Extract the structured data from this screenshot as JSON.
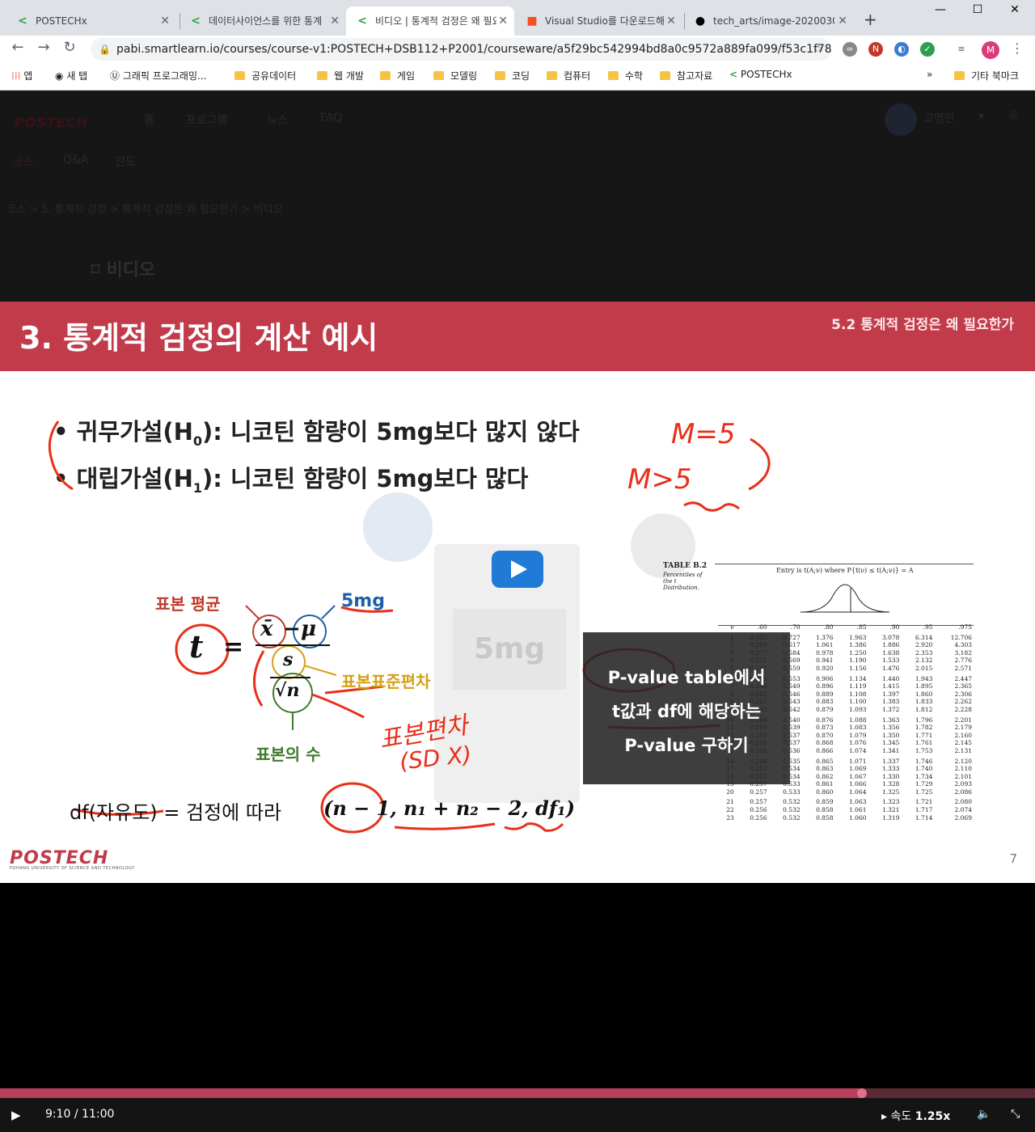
{
  "browser": {
    "tabs": [
      {
        "title": "POSTECHx"
      },
      {
        "title": "데이터사이언스를 위한 통계"
      },
      {
        "title": "비디오 | 통계적 검정은 왜 필요한가"
      },
      {
        "title": "Visual Studio를 다운로드해"
      },
      {
        "title": "tech_arts/image-2020030"
      }
    ],
    "url": "pabi.smartlearn.io/courses/course-v1:POSTECH+DSB112+P2001/courseware/a5f29bc542994bd8a0c9572a889fa099/f53c1f78ceb24055a...",
    "profile_initial": "M",
    "bookmarks": [
      "앱",
      "새 탭",
      "그래픽 프로그래밍...",
      "공유데이터",
      "웹 개발",
      "게임",
      "모델링",
      "코딩",
      "컴퓨터",
      "수학",
      "참고자료",
      "POSTECHx"
    ],
    "bookmarks_more": "»",
    "other_bookmarks": "기타 북마크"
  },
  "site": {
    "logo": "POSTECH",
    "nav": [
      "홈",
      "프로그램",
      "뉴스",
      "FAQ"
    ],
    "user": "고영인",
    "subnav": [
      "코스",
      "Q&A",
      "진도"
    ],
    "breadcrumb": "코스 > 5. 통계적 검정 > 통계적 검정은 왜 필요한가 > 비디오",
    "video_title": "비디오"
  },
  "slide": {
    "title": "3. 통계적 검정의 계산 예시",
    "section": "5.2 통계적 검정은 왜 필요한가",
    "h0_prefix": "귀무가설(H",
    "h0_sub": "0",
    "h0_rest": "): 니코틴 함량이 5mg보다 많지 않다",
    "h1_prefix": "대립가설(H",
    "h1_sub": "1",
    "h1_rest": "): 니코틴 함량이 5mg보다 많다",
    "hand_h0": "M=5",
    "hand_h1": "M>5",
    "label_mean": "표본 평균",
    "label_5mg": "5mg",
    "label_sd": "표본표준편차",
    "label_n": "표본의 수",
    "hand_sd": "표본편차",
    "hand_sd2": "(SD X)",
    "formula_t": "t",
    "formula_eq": "=",
    "formula_xbar": "x̄",
    "formula_minus": "−",
    "formula_mu": "μ",
    "formula_s": "s",
    "formula_sqrtn": "√n",
    "df_text": "df(자유도) = 검정에 따라",
    "df_values": "(n − 1, n₁ + n₂ − 2, df₁)",
    "cigarette_text": "5mg",
    "overlay_lines": [
      "P-value table에서",
      "t값과 df에 해당하는",
      "P-value 구하기"
    ],
    "table_title": "TABLE B.2",
    "table_subtitle": "Percentiles of the t Distribution.",
    "table_entry": "Entry is t(A;ν) where P{t(ν) ≤ t(A;ν)} = A",
    "table_header": [
      "ν",
      ".60",
      ".70",
      ".80",
      ".85",
      ".90",
      ".95",
      ".975"
    ],
    "table_rows": [
      [
        "1",
        "0.325",
        "0.727",
        "1.376",
        "1.963",
        "3.078",
        "6.314",
        "12.706"
      ],
      [
        "2",
        "0.289",
        "0.617",
        "1.061",
        "1.386",
        "1.886",
        "2.920",
        "4.303"
      ],
      [
        "3",
        "0.277",
        "0.584",
        "0.978",
        "1.250",
        "1.638",
        "2.353",
        "3.182"
      ],
      [
        "4",
        "0.271",
        "0.569",
        "0.941",
        "1.190",
        "1.533",
        "2.132",
        "2.776"
      ],
      [
        "5",
        "0.267",
        "0.559",
        "0.920",
        "1.156",
        "1.476",
        "2.015",
        "2.571"
      ],
      [
        "6",
        "0.265",
        "0.553",
        "0.906",
        "1.134",
        "1.440",
        "1.943",
        "2.447"
      ],
      [
        "7",
        "0.263",
        "0.549",
        "0.896",
        "1.119",
        "1.415",
        "1.895",
        "2.365"
      ],
      [
        "8",
        "0.262",
        "0.546",
        "0.889",
        "1.108",
        "1.397",
        "1.860",
        "2.306"
      ],
      [
        "9",
        "0.261",
        "0.543",
        "0.883",
        "1.100",
        "1.383",
        "1.833",
        "2.262"
      ],
      [
        "10",
        "0.260",
        "0.542",
        "0.879",
        "1.093",
        "1.372",
        "1.812",
        "2.228"
      ],
      [
        "11",
        "0.260",
        "0.540",
        "0.876",
        "1.088",
        "1.363",
        "1.796",
        "2.201"
      ],
      [
        "12",
        "0.259",
        "0.539",
        "0.873",
        "1.083",
        "1.356",
        "1.782",
        "2.179"
      ],
      [
        "13",
        "0.259",
        "0.537",
        "0.870",
        "1.079",
        "1.350",
        "1.771",
        "2.160"
      ],
      [
        "14",
        "0.258",
        "0.537",
        "0.868",
        "1.076",
        "1.345",
        "1.761",
        "2.145"
      ],
      [
        "15",
        "0.258",
        "0.536",
        "0.866",
        "1.074",
        "1.341",
        "1.753",
        "2.131"
      ],
      [
        "16",
        "0.258",
        "0.535",
        "0.865",
        "1.071",
        "1.337",
        "1.746",
        "2.120"
      ],
      [
        "17",
        "0.257",
        "0.534",
        "0.863",
        "1.069",
        "1.333",
        "1.740",
        "2.110"
      ],
      [
        "18",
        "0.257",
        "0.534",
        "0.862",
        "1.067",
        "1.330",
        "1.734",
        "2.101"
      ],
      [
        "19",
        "0.257",
        "0.533",
        "0.861",
        "1.066",
        "1.328",
        "1.729",
        "2.093"
      ],
      [
        "20",
        "0.257",
        "0.533",
        "0.860",
        "1.064",
        "1.325",
        "1.725",
        "2.086"
      ],
      [
        "21",
        "0.257",
        "0.532",
        "0.859",
        "1.063",
        "1.323",
        "1.721",
        "2.080"
      ],
      [
        "22",
        "0.256",
        "0.532",
        "0.858",
        "1.061",
        "1.321",
        "1.717",
        "2.074"
      ],
      [
        "23",
        "0.256",
        "0.532",
        "0.858",
        "1.060",
        "1.319",
        "1.714",
        "2.069"
      ]
    ],
    "logo": "POSTECH",
    "logo_sub": "POHANG UNIVERSITY OF SCIENCE AND TECHNOLOGY",
    "page_number": "7"
  },
  "player": {
    "time": "9:10 / 11:00",
    "progress": 0.833,
    "speed_label": "속도",
    "speed_value": "1.25x"
  }
}
